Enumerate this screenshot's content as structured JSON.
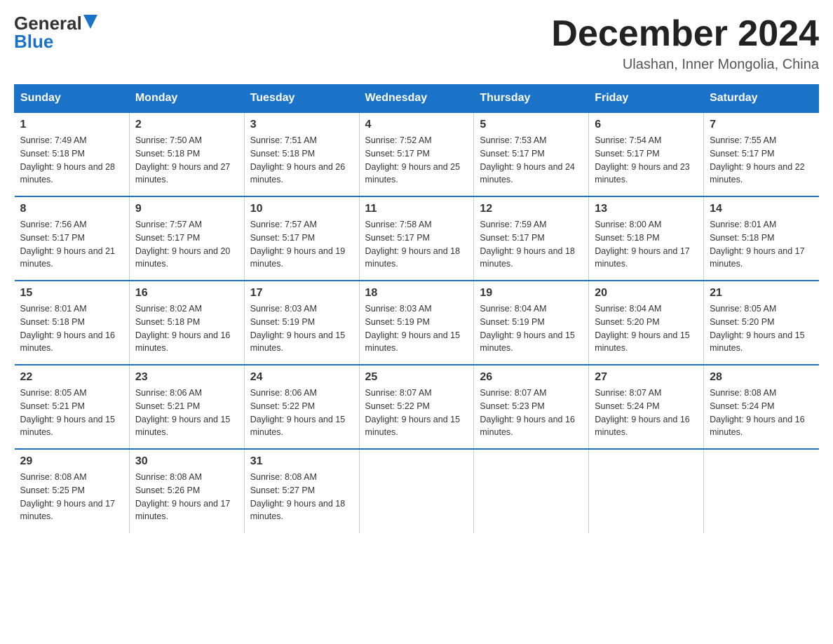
{
  "logo": {
    "general": "General",
    "blue": "Blue"
  },
  "title": "December 2024",
  "location": "Ulashan, Inner Mongolia, China",
  "days_of_week": [
    "Sunday",
    "Monday",
    "Tuesday",
    "Wednesday",
    "Thursday",
    "Friday",
    "Saturday"
  ],
  "weeks": [
    [
      {
        "day": "1",
        "sunrise": "7:49 AM",
        "sunset": "5:18 PM",
        "daylight": "9 hours and 28 minutes."
      },
      {
        "day": "2",
        "sunrise": "7:50 AM",
        "sunset": "5:18 PM",
        "daylight": "9 hours and 27 minutes."
      },
      {
        "day": "3",
        "sunrise": "7:51 AM",
        "sunset": "5:18 PM",
        "daylight": "9 hours and 26 minutes."
      },
      {
        "day": "4",
        "sunrise": "7:52 AM",
        "sunset": "5:17 PM",
        "daylight": "9 hours and 25 minutes."
      },
      {
        "day": "5",
        "sunrise": "7:53 AM",
        "sunset": "5:17 PM",
        "daylight": "9 hours and 24 minutes."
      },
      {
        "day": "6",
        "sunrise": "7:54 AM",
        "sunset": "5:17 PM",
        "daylight": "9 hours and 23 minutes."
      },
      {
        "day": "7",
        "sunrise": "7:55 AM",
        "sunset": "5:17 PM",
        "daylight": "9 hours and 22 minutes."
      }
    ],
    [
      {
        "day": "8",
        "sunrise": "7:56 AM",
        "sunset": "5:17 PM",
        "daylight": "9 hours and 21 minutes."
      },
      {
        "day": "9",
        "sunrise": "7:57 AM",
        "sunset": "5:17 PM",
        "daylight": "9 hours and 20 minutes."
      },
      {
        "day": "10",
        "sunrise": "7:57 AM",
        "sunset": "5:17 PM",
        "daylight": "9 hours and 19 minutes."
      },
      {
        "day": "11",
        "sunrise": "7:58 AM",
        "sunset": "5:17 PM",
        "daylight": "9 hours and 18 minutes."
      },
      {
        "day": "12",
        "sunrise": "7:59 AM",
        "sunset": "5:17 PM",
        "daylight": "9 hours and 18 minutes."
      },
      {
        "day": "13",
        "sunrise": "8:00 AM",
        "sunset": "5:18 PM",
        "daylight": "9 hours and 17 minutes."
      },
      {
        "day": "14",
        "sunrise": "8:01 AM",
        "sunset": "5:18 PM",
        "daylight": "9 hours and 17 minutes."
      }
    ],
    [
      {
        "day": "15",
        "sunrise": "8:01 AM",
        "sunset": "5:18 PM",
        "daylight": "9 hours and 16 minutes."
      },
      {
        "day": "16",
        "sunrise": "8:02 AM",
        "sunset": "5:18 PM",
        "daylight": "9 hours and 16 minutes."
      },
      {
        "day": "17",
        "sunrise": "8:03 AM",
        "sunset": "5:19 PM",
        "daylight": "9 hours and 15 minutes."
      },
      {
        "day": "18",
        "sunrise": "8:03 AM",
        "sunset": "5:19 PM",
        "daylight": "9 hours and 15 minutes."
      },
      {
        "day": "19",
        "sunrise": "8:04 AM",
        "sunset": "5:19 PM",
        "daylight": "9 hours and 15 minutes."
      },
      {
        "day": "20",
        "sunrise": "8:04 AM",
        "sunset": "5:20 PM",
        "daylight": "9 hours and 15 minutes."
      },
      {
        "day": "21",
        "sunrise": "8:05 AM",
        "sunset": "5:20 PM",
        "daylight": "9 hours and 15 minutes."
      }
    ],
    [
      {
        "day": "22",
        "sunrise": "8:05 AM",
        "sunset": "5:21 PM",
        "daylight": "9 hours and 15 minutes."
      },
      {
        "day": "23",
        "sunrise": "8:06 AM",
        "sunset": "5:21 PM",
        "daylight": "9 hours and 15 minutes."
      },
      {
        "day": "24",
        "sunrise": "8:06 AM",
        "sunset": "5:22 PM",
        "daylight": "9 hours and 15 minutes."
      },
      {
        "day": "25",
        "sunrise": "8:07 AM",
        "sunset": "5:22 PM",
        "daylight": "9 hours and 15 minutes."
      },
      {
        "day": "26",
        "sunrise": "8:07 AM",
        "sunset": "5:23 PM",
        "daylight": "9 hours and 16 minutes."
      },
      {
        "day": "27",
        "sunrise": "8:07 AM",
        "sunset": "5:24 PM",
        "daylight": "9 hours and 16 minutes."
      },
      {
        "day": "28",
        "sunrise": "8:08 AM",
        "sunset": "5:24 PM",
        "daylight": "9 hours and 16 minutes."
      }
    ],
    [
      {
        "day": "29",
        "sunrise": "8:08 AM",
        "sunset": "5:25 PM",
        "daylight": "9 hours and 17 minutes."
      },
      {
        "day": "30",
        "sunrise": "8:08 AM",
        "sunset": "5:26 PM",
        "daylight": "9 hours and 17 minutes."
      },
      {
        "day": "31",
        "sunrise": "8:08 AM",
        "sunset": "5:27 PM",
        "daylight": "9 hours and 18 minutes."
      },
      null,
      null,
      null,
      null
    ]
  ]
}
